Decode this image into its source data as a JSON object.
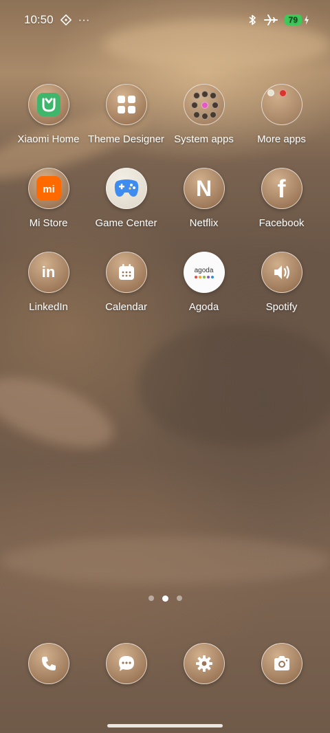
{
  "status_bar": {
    "time": "10:50",
    "overflow": "···",
    "battery_level": "79"
  },
  "apps": [
    {
      "label": "Xiaomi Home",
      "icon": "xiaomi-home-icon"
    },
    {
      "label": "Theme Designer",
      "icon": "theme-designer-icon"
    },
    {
      "label": "System apps",
      "icon": "system-apps-folder-icon"
    },
    {
      "label": "More apps",
      "icon": "more-apps-folder-icon"
    },
    {
      "label": "Mi Store",
      "icon": "mi-store-icon"
    },
    {
      "label": "Game Center",
      "icon": "game-center-icon"
    },
    {
      "label": "Netflix",
      "icon": "netflix-icon"
    },
    {
      "label": "Facebook",
      "icon": "facebook-icon"
    },
    {
      "label": "LinkedIn",
      "icon": "linkedin-icon"
    },
    {
      "label": "Calendar",
      "icon": "calendar-icon"
    },
    {
      "label": "Agoda",
      "icon": "agoda-icon"
    },
    {
      "label": "Spotify",
      "icon": "spotify-icon"
    }
  ],
  "agoda_logo_text": "agoda",
  "netflix_glyph": "N",
  "facebook_glyph": "f",
  "linkedin_glyph": "in",
  "mi_store_glyph": "mi",
  "dock": [
    {
      "icon": "phone-icon"
    },
    {
      "icon": "messages-icon"
    },
    {
      "icon": "settings-icon"
    },
    {
      "icon": "camera-icon"
    }
  ],
  "pages": {
    "count": 3,
    "active": 2
  },
  "colors": {
    "battery_green": "#3ec85a",
    "xiaomi_home_green": "#3fb66b",
    "mi_orange": "#ff6a00",
    "game_center_blue": "#3f8cf0"
  }
}
